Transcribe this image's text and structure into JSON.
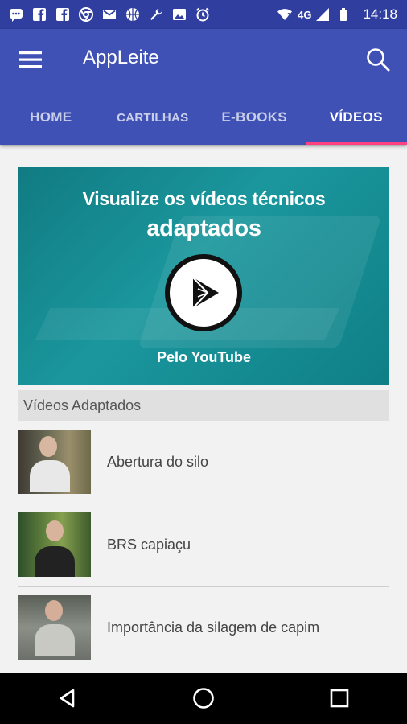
{
  "status_bar": {
    "network": "4G",
    "time": "14:18",
    "notification_icons": [
      "chat-icon",
      "facebook-icon",
      "facebook-icon",
      "chrome-icon",
      "mail-icon",
      "basketball-icon",
      "wrench-icon",
      "image-icon",
      "alarm-icon"
    ]
  },
  "app_bar": {
    "title": "AppLeite",
    "color": "#3f51b5",
    "status_color": "#303f9f",
    "accent": "#ff4081"
  },
  "tabs": [
    {
      "label": "HOME",
      "active": false
    },
    {
      "label": "CARTILHAS",
      "active": false
    },
    {
      "label": "E-BOOKS",
      "active": false
    },
    {
      "label": "VÍDEOS",
      "active": true
    }
  ],
  "banner": {
    "title_line1": "Visualize os vídeos técnicos",
    "title_line2": "adaptados",
    "subtitle": "Pelo YouTube"
  },
  "section": {
    "header": "Vídeos Adaptados"
  },
  "videos": [
    {
      "title": "Abertura do silo"
    },
    {
      "title": "BRS capiaçu"
    },
    {
      "title": "Importância da silagem de capim"
    }
  ]
}
